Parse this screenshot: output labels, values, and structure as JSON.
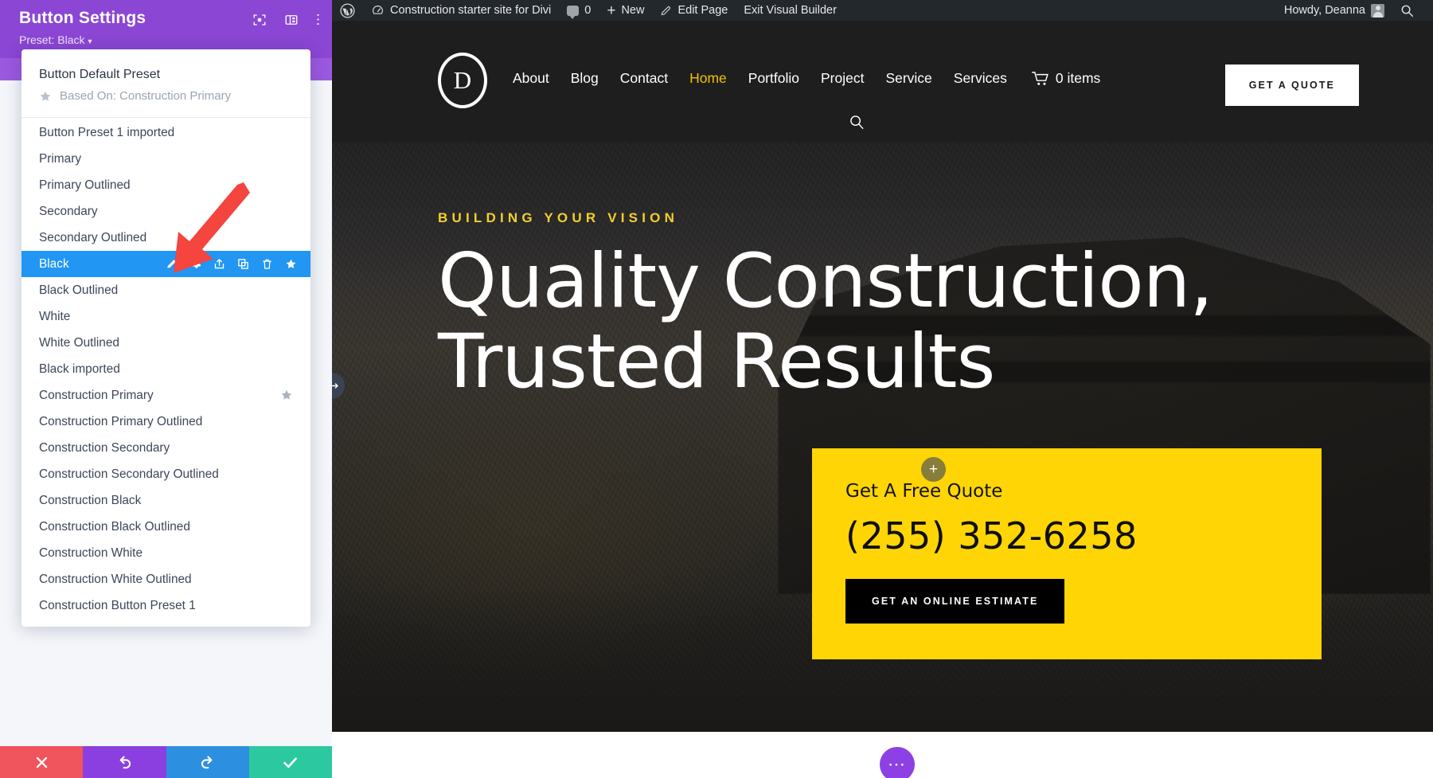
{
  "adminbar": {
    "wp_logo_icon": "wordpress-logo-icon",
    "site_icon": "dashboard-icon",
    "site_name": "Construction starter site for Divi",
    "comments_icon": "comment-bubble-icon",
    "comments_count": "0",
    "new_icon": "plus-icon",
    "new_label": "New",
    "edit_icon": "pencil-icon",
    "edit_label": "Edit Page",
    "exit_label": "Exit Visual Builder",
    "howdy": "Howdy, Deanna",
    "avatar_icon": "avatar-icon",
    "search_icon": "search-icon"
  },
  "site": {
    "logo_letter": "D",
    "nav": [
      {
        "label": "About",
        "active": false
      },
      {
        "label": "Blog",
        "active": false
      },
      {
        "label": "Contact",
        "active": false
      },
      {
        "label": "Home",
        "active": true
      },
      {
        "label": "Portfolio",
        "active": false
      },
      {
        "label": "Project",
        "active": false
      },
      {
        "label": "Service",
        "active": false
      },
      {
        "label": "Services",
        "active": false
      }
    ],
    "cart_icon": "shopping-cart-icon",
    "cart_count": "0 items",
    "search_icon": "search-icon",
    "quote_button": "GET A QUOTE",
    "hero": {
      "eyebrow": "BUILDING YOUR VISION",
      "title_line1": "Quality Construction,",
      "title_line2": "Trusted Results"
    },
    "quote_card": {
      "label": "Get A Free Quote",
      "phone": "(255) 352-6258",
      "button": "GET AN ONLINE ESTIMATE",
      "bg_color": "#ffd505"
    },
    "builder_controls": {
      "section_menu_icon": "ellipsis-icon",
      "resize_handle_icon": "horizontal-resize-icon",
      "add_module_icon": "plus-icon",
      "row_menu_icon": "vertical-ellipsis-icon"
    }
  },
  "panel": {
    "title": "Button Settings",
    "preset_label": "Preset: Black",
    "header_icons": [
      {
        "name": "focus-target-icon"
      },
      {
        "name": "layout-columns-icon"
      },
      {
        "name": "vertical-ellipsis-icon"
      }
    ],
    "accent_color": "#8b46d4",
    "selected_color": "#2196f3",
    "dropdown": {
      "default_preset": "Button Default Preset",
      "based_on": "Based On: Construction Primary",
      "based_on_icon": "star-icon",
      "items": [
        {
          "label": "Button Preset 1 imported",
          "selected": false,
          "favorite": false
        },
        {
          "label": "Primary",
          "selected": false,
          "favorite": false
        },
        {
          "label": "Primary Outlined",
          "selected": false,
          "favorite": false
        },
        {
          "label": "Secondary",
          "selected": false,
          "favorite": false
        },
        {
          "label": "Secondary Outlined",
          "selected": false,
          "favorite": false
        },
        {
          "label": "Black",
          "selected": true,
          "favorite": false
        },
        {
          "label": "Black Outlined",
          "selected": false,
          "favorite": false
        },
        {
          "label": "White",
          "selected": false,
          "favorite": false
        },
        {
          "label": "White Outlined",
          "selected": false,
          "favorite": false
        },
        {
          "label": "Black imported",
          "selected": false,
          "favorite": false
        },
        {
          "label": "Construction Primary",
          "selected": false,
          "favorite": true
        },
        {
          "label": "Construction Primary Outlined",
          "selected": false,
          "favorite": false
        },
        {
          "label": "Construction Secondary",
          "selected": false,
          "favorite": false
        },
        {
          "label": "Construction Secondary Outlined",
          "selected": false,
          "favorite": false
        },
        {
          "label": "Construction Black",
          "selected": false,
          "favorite": false
        },
        {
          "label": "Construction Black Outlined",
          "selected": false,
          "favorite": false
        },
        {
          "label": "Construction White",
          "selected": false,
          "favorite": false
        },
        {
          "label": "Construction White Outlined",
          "selected": false,
          "favorite": false
        },
        {
          "label": "Construction Button Preset 1",
          "selected": false,
          "favorite": false
        }
      ],
      "row_actions": [
        {
          "name": "rename-pencil-icon"
        },
        {
          "name": "gear-settings-icon"
        },
        {
          "name": "export-icon"
        },
        {
          "name": "duplicate-icon"
        },
        {
          "name": "delete-trash-icon"
        },
        {
          "name": "favorite-star-icon"
        }
      ]
    },
    "actions": [
      {
        "name": "cancel-button",
        "icon": "close-x-icon",
        "color": "#f0545c"
      },
      {
        "name": "undo-button",
        "icon": "undo-arrow-icon",
        "color": "#8b3fe0"
      },
      {
        "name": "redo-button",
        "icon": "redo-arrow-icon",
        "color": "#2d8fe0"
      },
      {
        "name": "save-button",
        "icon": "checkmark-icon",
        "color": "#2cc9a0"
      }
    ]
  },
  "annotation": {
    "arrow_color": "#f4453f",
    "name": "pointer-arrow"
  }
}
